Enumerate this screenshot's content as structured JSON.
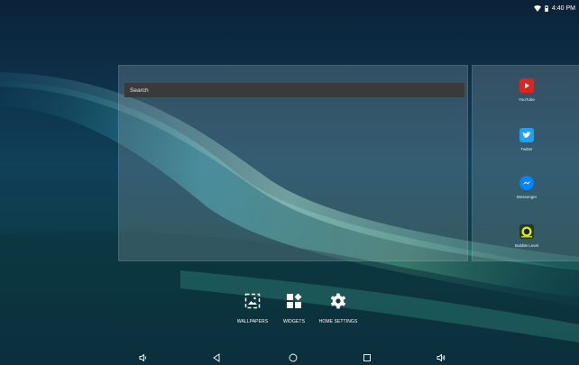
{
  "status": {
    "time": "4:40 PM"
  },
  "search": {
    "label": "Search"
  },
  "apps": [
    {
      "label": "YouTube",
      "icon": "youtube-icon",
      "color": "#e62117"
    },
    {
      "label": "Twitter",
      "icon": "twitter-icon",
      "color": "#1da1f2"
    },
    {
      "label": "Messenger",
      "icon": "messenger-icon",
      "color": "#0084ff"
    },
    {
      "label": "Bubble Level",
      "icon": "bubble-level-icon",
      "color": "#2b3a12"
    }
  ],
  "actions": {
    "wallpapers": "WALLPAPERS",
    "widgets": "WIDGETS",
    "home_settings": "HOME SETTINGS"
  },
  "nav": [
    "volume-down-icon",
    "back-icon",
    "home-icon",
    "recents-icon",
    "volume-up-icon"
  ]
}
